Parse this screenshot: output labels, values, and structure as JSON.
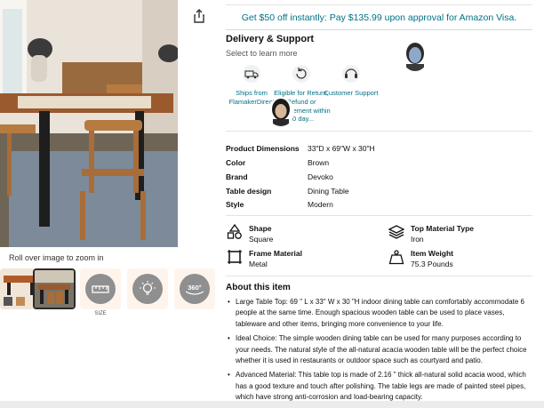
{
  "promo": "Get $50 off instantly: Pay $135.99 upon approval for Amazon Visa.",
  "delivery": {
    "title": "Delivery & Support",
    "subtitle": "Select to learn more",
    "items": [
      {
        "icon": "truck-icon",
        "label": "Ships from FlamakerDirect"
      },
      {
        "icon": "return-icon",
        "label": "Eligible for Return, Refund or Replacement within 30 day..."
      },
      {
        "icon": "headset-icon",
        "label": "Customer Support"
      }
    ]
  },
  "specs": [
    {
      "key": "Product Dimensions",
      "value": "33\"D x 69\"W x 30\"H"
    },
    {
      "key": "Color",
      "value": "Brown"
    },
    {
      "key": "Brand",
      "value": "Devoko"
    },
    {
      "key": "Table design",
      "value": "Dining Table"
    },
    {
      "key": "Style",
      "value": "Modern"
    }
  ],
  "attributes": [
    {
      "icon": "shapes-icon",
      "title": "Shape",
      "value": "Square"
    },
    {
      "icon": "layers-icon",
      "title": "Top Material Type",
      "value": "Iron"
    },
    {
      "icon": "frame-icon",
      "title": "Frame Material",
      "value": "Metal"
    },
    {
      "icon": "weight-icon",
      "title": "Item Weight",
      "value": "75.3 Pounds"
    }
  ],
  "gallery": {
    "zoom_hint": "Roll over image to zoom in",
    "thumb_caption": "SIZE"
  },
  "about": {
    "title": "About this item",
    "bullets": [
      "Large Table Top: 69 \" L x 33\" W x 30 \"H indoor dining table can comfortably accommodate 6 people at the same time. Enough spacious wooden table can be used to place vases, tableware and other items, bringing more convenience to your life.",
      "Ideal Choice: The simple wooden dining table can be used for many purposes according to your needs. The natural style of the all-natural acacia wooden table will be the perfect choice whether it is used in restaurants or outdoor space such as courtyard and patio.",
      "Advanced Material: This table top is made of 2.16 \" thick all-natural solid acacia wood, which has a good texture and touch after polishing. The table legs are made of painted steel pipes, which have strong anti-corrosion and load-bearing capacity."
    ]
  },
  "colors": {
    "link": "#007185",
    "accent_bg": "#fff4ec"
  }
}
